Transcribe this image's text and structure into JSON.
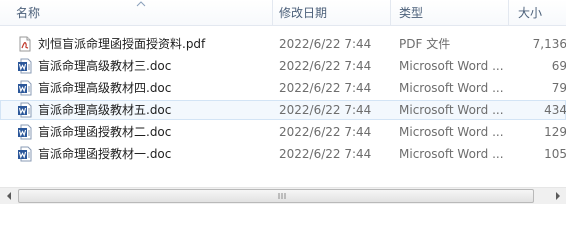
{
  "columns": {
    "name": "名称",
    "date": "修改日期",
    "type": "类型",
    "size": "大小"
  },
  "files": [
    {
      "name": "刘恒盲派命理函授面授资料.pdf",
      "date": "2022/6/22 7:44",
      "type": "PDF 文件",
      "size": "7,136",
      "icon": "pdf-file-icon"
    },
    {
      "name": "盲派命理高级教材三.doc",
      "date": "2022/6/22 7:44",
      "type": "Microsoft Word ...",
      "size": "69",
      "icon": "word-doc-icon"
    },
    {
      "name": "盲派命理高级教材四.doc",
      "date": "2022/6/22 7:44",
      "type": "Microsoft Word ...",
      "size": "79",
      "icon": "word-doc-icon"
    },
    {
      "name": "盲派命理高级教材五.doc",
      "date": "2022/6/22 7:44",
      "type": "Microsoft Word ...",
      "size": "434",
      "icon": "word-doc-icon",
      "selected": true
    },
    {
      "name": "盲派命理函授教材二.doc",
      "date": "2022/6/22 7:44",
      "type": "Microsoft Word ...",
      "size": "129",
      "icon": "word-doc-icon"
    },
    {
      "name": "盲派命理函授教材一.doc",
      "date": "2022/6/22 7:44",
      "type": "Microsoft Word ...",
      "size": "105",
      "icon": "word-doc-icon"
    }
  ],
  "colors": {
    "header_text": "#4c607a",
    "selection_bg": "#f3f8fd",
    "selection_border": "#d3e4f5",
    "word_icon_blue": "#2b579a"
  }
}
